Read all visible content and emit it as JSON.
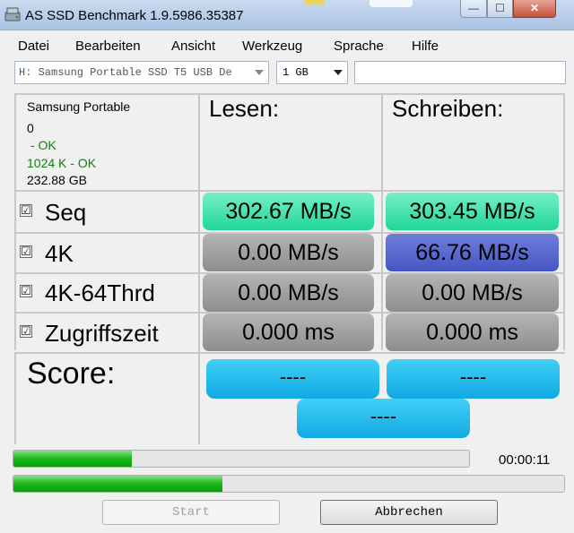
{
  "window": {
    "title": "AS SSD Benchmark 1.9.5986.35387",
    "minimize_glyph": "—",
    "maximize_glyph": "☐",
    "close_glyph": "✕"
  },
  "menu": [
    "Datei",
    "Bearbeiten",
    "Ansicht",
    "Werkzeug",
    "Sprache",
    "Hilfe"
  ],
  "drive_select": {
    "value": "H: Samsung Portable SSD T5 USB De"
  },
  "size_select": {
    "value": "1 GB"
  },
  "drive_info": {
    "name": "Samsung Portable",
    "line2": "0",
    "line3": " - OK",
    "line4": "1024 K - OK",
    "capacity": "232.88 GB"
  },
  "columns": {
    "read": "Lesen:",
    "write": "Schreiben:"
  },
  "tests": [
    {
      "label": "Seq",
      "checked": true,
      "read": "302.67 MB/s",
      "write": "303.45 MB/s"
    },
    {
      "label": "4K",
      "checked": true,
      "read": "0.00 MB/s",
      "write": "66.76 MB/s"
    },
    {
      "label": "4K-64Thrd",
      "checked": true,
      "read": "0.00 MB/s",
      "write": "0.00 MB/s"
    },
    {
      "label": "Zugriffszeit",
      "checked": true,
      "read": "0.000 ms",
      "write": "0.000 ms"
    }
  ],
  "checkbox_glyph": "☑",
  "score": {
    "label": "Score:",
    "read": "----",
    "write": "----",
    "total": "----"
  },
  "progress": {
    "test_fraction": 0.26,
    "total_fraction": 0.38,
    "elapsed": "00:00:11"
  },
  "buttons": {
    "start": "Start",
    "abort": "Abbrechen"
  },
  "colors": {
    "fast": "#22d69a",
    "idle": "#9a9a9a",
    "running": "#4556c4",
    "score": "#12a9e4",
    "progress": "#1cb61c"
  }
}
